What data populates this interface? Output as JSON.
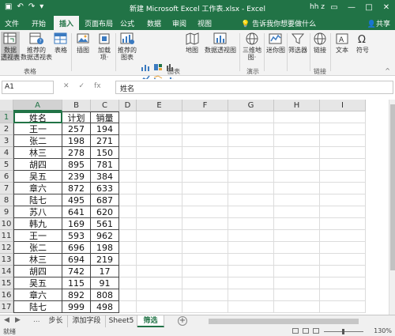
{
  "app": {
    "title": "新建 Microsoft Excel 工作表.xlsx - Excel",
    "user": "hh z",
    "window_controls": [
      "restore-icon",
      "minimize-icon",
      "maximize-icon",
      "close-icon"
    ],
    "brand_color": "#217346"
  },
  "ribbon_tabs": [
    "文件",
    "开始",
    "插入",
    "页面布局",
    "公式",
    "数据",
    "审阅",
    "视图"
  ],
  "active_tab": "插入",
  "tell_me": "告诉我你想要做什么",
  "share": "共享",
  "ribbon": {
    "buttons": [
      {
        "label1": "数据",
        "label2": "透视表",
        "icon": "pivot-table-icon"
      },
      {
        "label1": "推荐的",
        "label2": "数据透视表",
        "icon": "recommended-pivot-icon"
      },
      {
        "label1": "表格",
        "label2": "",
        "icon": "table-icon"
      },
      {
        "label1": "插图",
        "label2": "",
        "icon": "illustrations-icon"
      },
      {
        "label1": "加载",
        "label2": "项·",
        "icon": "addins-icon"
      },
      {
        "label1": "推荐的",
        "label2": "图表",
        "icon": "recommended-charts-icon"
      },
      {
        "label1": "地图",
        "label2": "",
        "icon": "maps-icon"
      },
      {
        "label1": "数据透视图",
        "label2": "",
        "icon": "pivot-chart-icon"
      },
      {
        "label1": "三维地",
        "label2": "图·",
        "icon": "3d-map-icon"
      },
      {
        "label1": "迷你图",
        "label2": "",
        "icon": "sparklines-icon"
      },
      {
        "label1": "筛选器",
        "label2": "",
        "icon": "filter-icon"
      },
      {
        "label1": "链接",
        "label2": "",
        "icon": "link-icon"
      },
      {
        "label1": "文本",
        "label2": "",
        "icon": "text-icon"
      },
      {
        "label1": "符号",
        "label2": "",
        "icon": "symbol-icon"
      }
    ],
    "groups": [
      "表格",
      "图表",
      "演示",
      "链接"
    ]
  },
  "formula_bar": {
    "name_box": "A1",
    "content": "姓名",
    "cancel": "✕",
    "enter": "✓",
    "fx": "fx"
  },
  "columns": [
    "A",
    "B",
    "C",
    "D",
    "E",
    "F",
    "G",
    "H",
    "I"
  ],
  "rows": [
    "1",
    "2",
    "3",
    "4",
    "5",
    "6",
    "7",
    "8",
    "9",
    "10",
    "11",
    "12",
    "13",
    "14",
    "15",
    "16",
    "17"
  ],
  "table": [
    [
      "姓名",
      "计划",
      "销量"
    ],
    [
      "王一",
      "257",
      "194"
    ],
    [
      "张二",
      "198",
      "271"
    ],
    [
      "林三",
      "278",
      "150"
    ],
    [
      "胡四",
      "895",
      "781"
    ],
    [
      "吴五",
      "239",
      "384"
    ],
    [
      "章六",
      "872",
      "633"
    ],
    [
      "陆七",
      "495",
      "687"
    ],
    [
      "苏八",
      "641",
      "620"
    ],
    [
      "韩九",
      "169",
      "561"
    ],
    [
      "王一",
      "593",
      "962"
    ],
    [
      "张二",
      "696",
      "198"
    ],
    [
      "林三",
      "694",
      "219"
    ],
    [
      "胡四",
      "742",
      "17"
    ],
    [
      "吴五",
      "115",
      "91"
    ],
    [
      "章六",
      "892",
      "808"
    ],
    [
      "陆七",
      "999",
      "498"
    ]
  ],
  "sheet_tabs": [
    "步长",
    "添加字段",
    "Sheet5",
    "筛选"
  ],
  "active_sheet": "筛选",
  "sheet_nav": [
    "◀",
    "▶",
    "..."
  ],
  "add_sheet": "+",
  "status": {
    "ready": "就绪",
    "zoom": "130%"
  }
}
